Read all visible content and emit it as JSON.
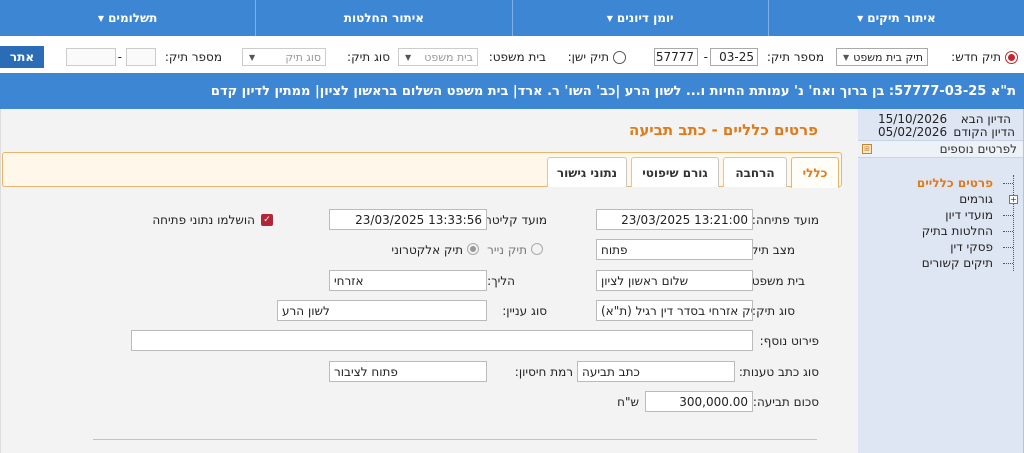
{
  "nav": {
    "items": [
      {
        "label": "איתור תיקים",
        "caret": true
      },
      {
        "label": "יומן דיונים",
        "caret": true
      },
      {
        "label": "איתור החלטות",
        "caret": false
      },
      {
        "label": "תשלומים",
        "caret": true
      }
    ]
  },
  "search": {
    "new_case_label": "תיק חדש:",
    "court_type_value": "תיק בית משפט",
    "case_number_label": "מספר תיק:",
    "case_num_part1": "57777",
    "case_num_part2": "03-25",
    "old_case_label": "תיק ישן:",
    "court_label": "בית משפט:",
    "court_placeholder": "בית משפט",
    "case_type_label": "סוג תיק:",
    "case_type_placeholder": "סוג תיק",
    "case_number2_label": "מספר תיק:",
    "dash": "-",
    "go_label": "אתר"
  },
  "case_bar": {
    "title": "ת\"א 57777-03-25: בן ברוך ואח' נ' עמותת החיות ו... לשון הרע |כב' השו' ר. ארד| בית משפט השלום בראשון לציון| ממתין לדיון קדם"
  },
  "side": {
    "next_hearing_label": "הדיון הבא",
    "next_hearing_date": "15/10/2026",
    "prev_hearing_label": "הדיון הקודם",
    "prev_hearing_date": "05/02/2026",
    "more_details": "לפרטים נוספים",
    "tree": [
      {
        "label": "פרטים כלליים",
        "active": true
      },
      {
        "label": "גורמים",
        "active": false
      },
      {
        "label": "מועדי דיון",
        "active": false
      },
      {
        "label": "החלטות בתיק",
        "active": false
      },
      {
        "label": "פסקי דין",
        "active": false
      },
      {
        "label": "תיקים קשורים",
        "active": false
      }
    ]
  },
  "main": {
    "title": "פרטים כלליים - כתב תביעה",
    "tabs": [
      "כללי",
      "הרחבה",
      "גורם שיפוטי",
      "נתוני גישור"
    ],
    "fields": {
      "open_date_label": "מועד פתיחה:",
      "open_date": "23/03/2025 13:21:00",
      "receive_date_label": "מועד קליטה:",
      "receive_date": "23/03/2025 13:33:56",
      "opening_data_label": "הושלמו נתוני פתיחה",
      "status_label": "מצב תיק:",
      "status": "פתוח",
      "paper_label": "תיק נייר",
      "electronic_label": "תיק אלקטרוני",
      "court_label": "בית משפט:",
      "court": "שלום ראשון לציון",
      "procedure_label": "הליך:",
      "procedure": "אזרחי",
      "case_type_label": "סוג תיק:",
      "case_type": "תיק אזרחי בסדר דין רגיל (ת\"א)",
      "subject_label": "סוג עניין:",
      "subject": "לשון הרע",
      "extra_label": "פירוט נוסף:",
      "extra": "",
      "claim_type_label": "סוג כתב טענות:",
      "claim_type": "כתב תביעה",
      "privacy_label": "רמת חיסיון:",
      "privacy": "פתוח לציבור",
      "amount_label": "סכום תביעה:",
      "amount": "300,000.00",
      "currency": "ש\"ח"
    }
  }
}
